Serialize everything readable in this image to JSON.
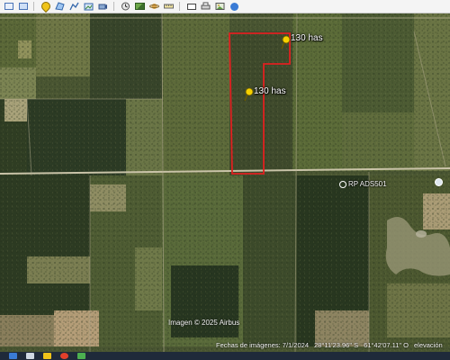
{
  "toolbar": {
    "items": [
      {
        "name": "sidebar-toggle-icon"
      },
      {
        "name": "window-icon"
      },
      {
        "name": "add-placemark-icon"
      },
      {
        "name": "add-polygon-icon"
      },
      {
        "name": "add-path-icon"
      },
      {
        "name": "add-overlay-icon"
      },
      {
        "name": "record-tour-icon"
      },
      {
        "name": "historical-imagery-icon"
      },
      {
        "name": "sunlight-icon"
      },
      {
        "name": "planets-icon"
      },
      {
        "name": "ruler-icon"
      },
      {
        "name": "email-icon"
      },
      {
        "name": "print-icon"
      },
      {
        "name": "save-image-icon"
      },
      {
        "name": "view-in-maps-icon"
      }
    ]
  },
  "map": {
    "labels": {
      "parcel_north": "130 has",
      "parcel_south": "130 has",
      "road": "RP ADS501"
    },
    "copyright": "Imagen © 2025 Airbus",
    "parcel_outline_color": "#e02020",
    "marker_color": "#f5d000"
  },
  "statusbar": {
    "imagery_date": "Fechas de imágenes: 7/1/2024",
    "latitude": "28°11'23.96\" S",
    "longitude": "61°42'07.11\" O",
    "elevation": "elevación"
  },
  "taskbar": {
    "items": [
      {
        "name": "windows-start-icon",
        "color": "#3a7bd5"
      },
      {
        "name": "search-icon",
        "color": "#cfd8e3"
      },
      {
        "name": "file-explorer-icon",
        "color": "#f0c419"
      },
      {
        "name": "browser-icon",
        "color": "#e2402b"
      },
      {
        "name": "maps-icon",
        "color": "#4caf50"
      }
    ]
  }
}
